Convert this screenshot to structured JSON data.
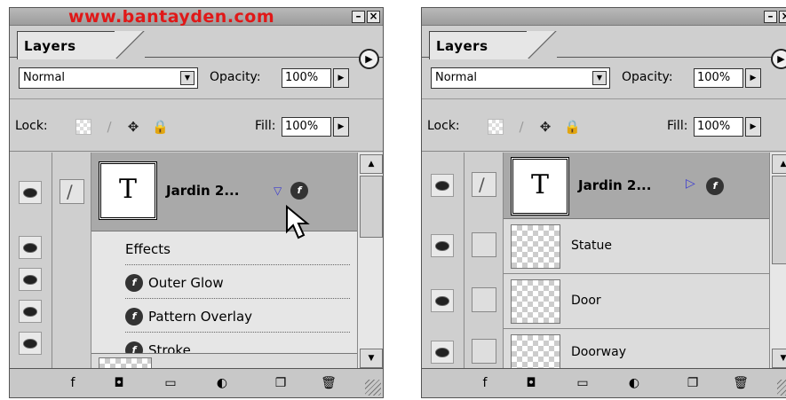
{
  "watermark": "www.bantayden.com",
  "colors": {
    "watermark": "#e01818",
    "selected_row": "#a9a9a9",
    "panel_bg": "#cfcfcf"
  },
  "panels": [
    {
      "tab_label": "Layers",
      "blend_mode": "Normal",
      "opacity_label": "Opacity:",
      "opacity_value": "100%",
      "lock_label": "Lock:",
      "fill_label": "Fill:",
      "fill_value": "100%",
      "selected_layer": {
        "name": "Jardin 2...",
        "thumb_letter": "T",
        "expand_icon": "triangle-down-icon"
      },
      "effects_header": "Effects",
      "effects": [
        "Outer Glow",
        "Pattern Overlay",
        "Stroke"
      ]
    },
    {
      "tab_label": "Layers",
      "blend_mode": "Normal",
      "opacity_label": "Opacity:",
      "opacity_value": "100%",
      "lock_label": "Lock:",
      "fill_label": "Fill:",
      "fill_value": "100%",
      "selected_layer": {
        "name": "Jardin 2...",
        "thumb_letter": "T",
        "expand_icon": "triangle-right-icon"
      },
      "layers": [
        "Statue",
        "Door",
        "Doorway"
      ]
    }
  ],
  "icons": {
    "fx": "f",
    "menu_arrow": "▶",
    "min": "–",
    "close": "×",
    "down_arrow": "▼",
    "up_arrow": "▲",
    "step_arrow": "▶",
    "move": "✥",
    "lock": "🔒",
    "brush": "∕",
    "mask": "◘",
    "folder": "▭",
    "adjust": "◐",
    "new_layer": "❐",
    "trash": "🗑"
  }
}
